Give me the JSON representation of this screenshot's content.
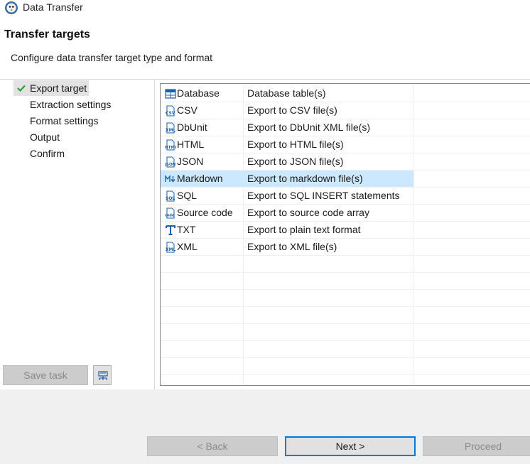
{
  "window": {
    "title": "Data Transfer",
    "icon": "dbeaver-beaver-icon"
  },
  "page": {
    "title": "Transfer targets",
    "description": "Configure data transfer target type and format"
  },
  "nav": {
    "items": [
      {
        "label": "Export target",
        "selected": true,
        "checked": true
      },
      {
        "label": "Extraction settings",
        "selected": false,
        "checked": false
      },
      {
        "label": "Format settings",
        "selected": false,
        "checked": false
      },
      {
        "label": "Output",
        "selected": false,
        "checked": false
      },
      {
        "label": "Confirm",
        "selected": false,
        "checked": false
      }
    ]
  },
  "left_buttons": {
    "save_task": "Save task",
    "schedule_icon": "schedule-task-icon"
  },
  "targets": [
    {
      "name": "Database",
      "description": "Database table(s)",
      "icon": "table-icon"
    },
    {
      "name": "CSV",
      "description": "Export to CSV file(s)",
      "icon": "csv-file-icon"
    },
    {
      "name": "DbUnit",
      "description": "Export to DbUnit XML file(s)",
      "icon": "xml-file-icon"
    },
    {
      "name": "HTML",
      "description": "Export to HTML file(s)",
      "icon": "html-file-icon"
    },
    {
      "name": "JSON",
      "description": "Export to JSON file(s)",
      "icon": "json-file-icon"
    },
    {
      "name": "Markdown",
      "description": "Export to markdown file(s)",
      "icon": "markdown-icon"
    },
    {
      "name": "SQL",
      "description": "Export to SQL INSERT statements",
      "icon": "sql-file-icon"
    },
    {
      "name": "Source code",
      "description": "Export to source code array",
      "icon": "code-file-icon"
    },
    {
      "name": "TXT",
      "description": "Export to plain text format",
      "icon": "text-format-icon"
    },
    {
      "name": "XML",
      "description": "Export to XML file(s)",
      "icon": "xml-file-icon"
    }
  ],
  "selected_target": "Markdown",
  "footer": {
    "back": "< Back",
    "next": "Next >",
    "proceed": "Proceed"
  },
  "colors": {
    "selection": "#cce8ff",
    "nav_selection": "#e2e2e2",
    "check": "#2e9e3c",
    "icon_blue": "#1e5fa8"
  }
}
